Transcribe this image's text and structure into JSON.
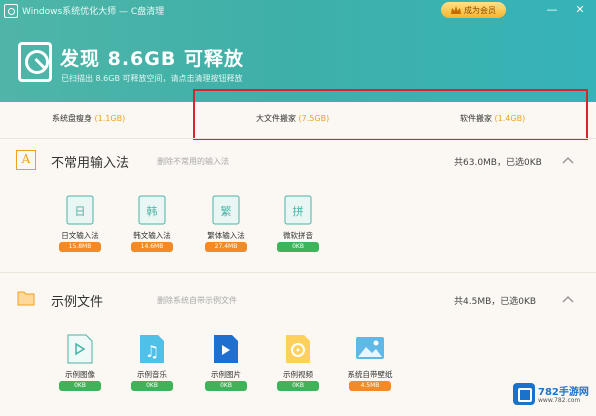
{
  "titlebar": {
    "app_title": "Windows系统优化大师 — C盘清理",
    "vip_label": "成为会员",
    "min_glyph": "—",
    "close_glyph": "✕"
  },
  "summary": {
    "title": "发现 8.6GB 可释放",
    "subtitle": "已扫描出 8.6GB 可释放空间，请点击清理按钮释放"
  },
  "tabs": [
    {
      "label": "系统盘瘦身",
      "size": "(1.1GB)"
    },
    {
      "label": "大文件搬家",
      "size": "(7.5GB)"
    },
    {
      "label": "软件搬家",
      "size": "(1.4GB)"
    }
  ],
  "sections": [
    {
      "title": "不常用输入法",
      "desc": "删除不常用的输入法",
      "total": "共63.0MB，已选0KB",
      "items": [
        {
          "label": "日文输入法",
          "badge": "15.8MB",
          "badge_color": "orange"
        },
        {
          "label": "韩文输入法",
          "badge": "14.6MB",
          "badge_color": "orange"
        },
        {
          "label": "繁体输入法",
          "badge": "27.4MB",
          "badge_color": "orange"
        },
        {
          "label": "微软拼音",
          "badge": "0KB",
          "badge_color": "green"
        }
      ]
    },
    {
      "title": "示例文件",
      "desc": "删除系统自带示例文件",
      "total": "共4.5MB，已选0KB",
      "items": [
        {
          "label": "示例图像",
          "badge": "0KB",
          "badge_color": "green"
        },
        {
          "label": "示例音乐",
          "badge": "0KB",
          "badge_color": "green"
        },
        {
          "label": "示例图片",
          "badge": "0KB",
          "badge_color": "green"
        },
        {
          "label": "示例视频",
          "badge": "0KB",
          "badge_color": "green"
        },
        {
          "label": "系统自带壁纸",
          "badge": "4.5MB",
          "badge_color": "orange"
        }
      ]
    }
  ],
  "watermark": {
    "brand": "782手游网",
    "url": "www.782.com"
  },
  "colors": {
    "accent": "#3fb0a8",
    "orange": "#f48a25",
    "green": "#3eb35a",
    "highlight_box": "#d9232d"
  }
}
